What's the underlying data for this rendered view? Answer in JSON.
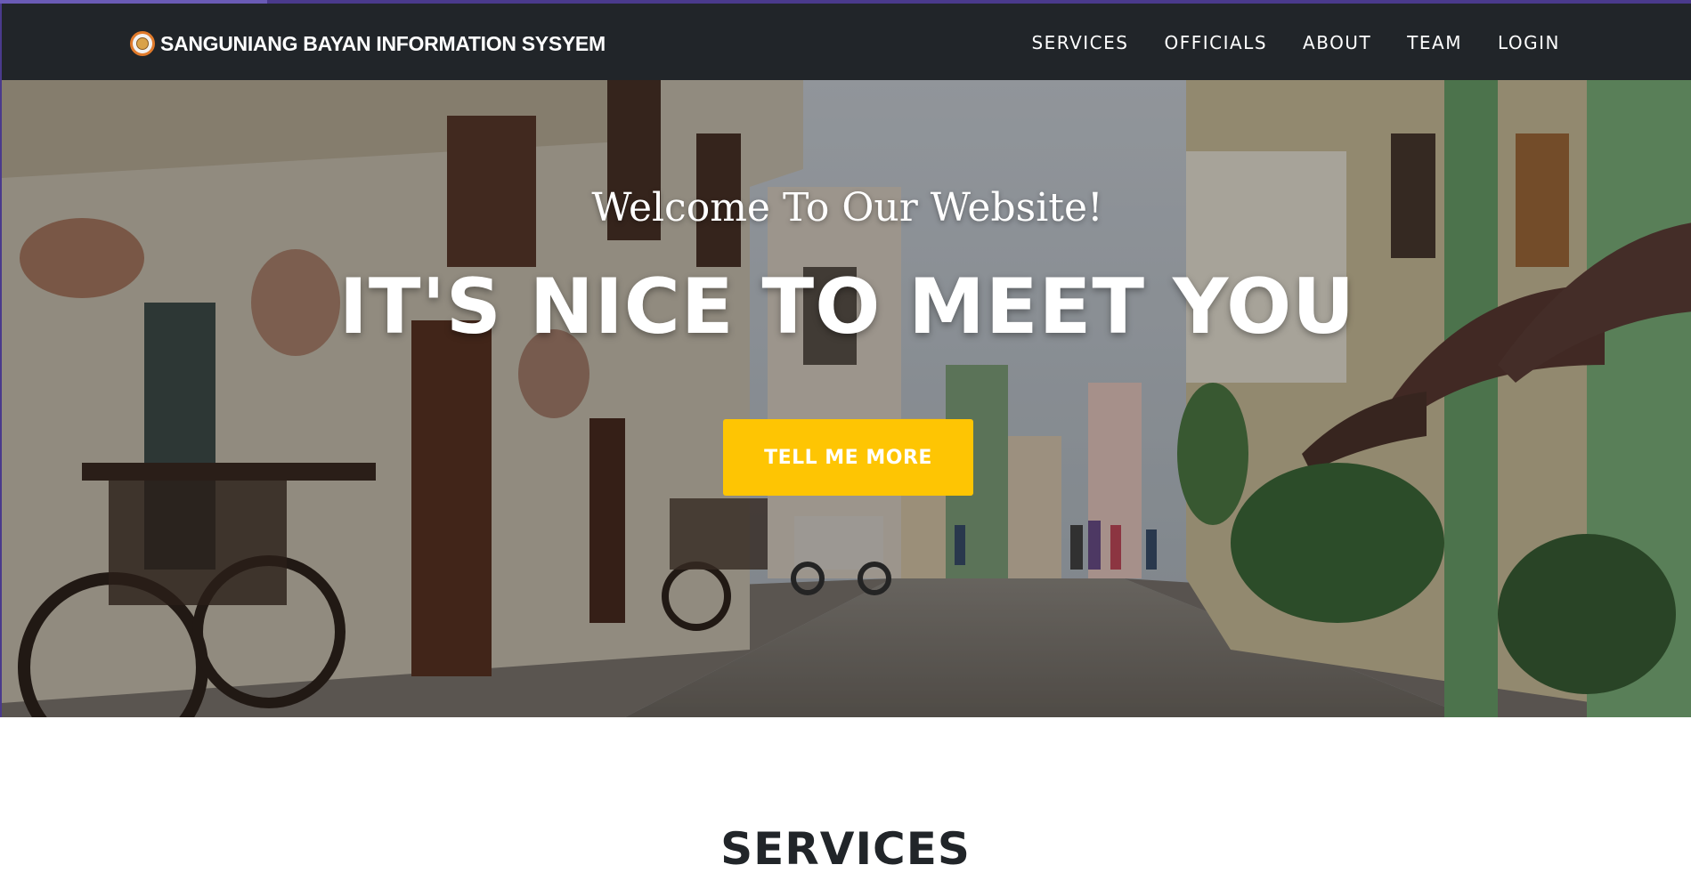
{
  "navbar": {
    "brand": "SANGUNIANG BAYAN INFORMATION SYSYEM",
    "links": [
      "SERVICES",
      "OFFICIALS",
      "ABOUT",
      "TEAM",
      "LOGIN"
    ]
  },
  "masthead": {
    "subheading": "Welcome To Our Website!",
    "heading": "IT'S NICE TO MEET YOU",
    "cta_label": "TELL ME MORE"
  },
  "services": {
    "title": "SERVICES"
  },
  "colors": {
    "navbar_bg": "#212529",
    "accent": "#fec503",
    "top_border": "#4a3a8c"
  },
  "icons": {
    "brand_logo": "seal-logo-icon"
  }
}
